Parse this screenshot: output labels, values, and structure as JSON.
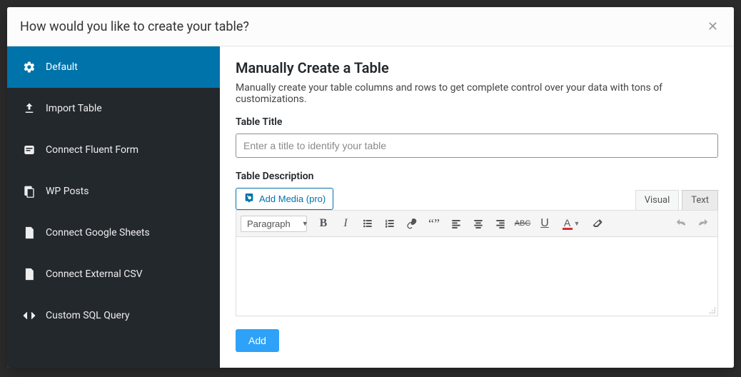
{
  "modal": {
    "title": "How would you like to create your table?"
  },
  "sidebar": {
    "items": [
      {
        "label": "Default"
      },
      {
        "label": "Import Table"
      },
      {
        "label": "Connect Fluent Form"
      },
      {
        "label": "WP Posts"
      },
      {
        "label": "Connect Google Sheets"
      },
      {
        "label": "Connect External CSV"
      },
      {
        "label": "Custom SQL Query"
      }
    ]
  },
  "main": {
    "heading": "Manually Create a Table",
    "description": "Manually create your table columns and rows to get complete control over your data with tons of customizations.",
    "title_label": "Table Title",
    "title_placeholder": "Enter a title to identify your table",
    "desc_label": "Table Description",
    "add_media_label": "Add Media (pro)",
    "tabs": {
      "visual": "Visual",
      "text": "Text"
    },
    "format_select": "Paragraph",
    "add_button": "Add"
  }
}
